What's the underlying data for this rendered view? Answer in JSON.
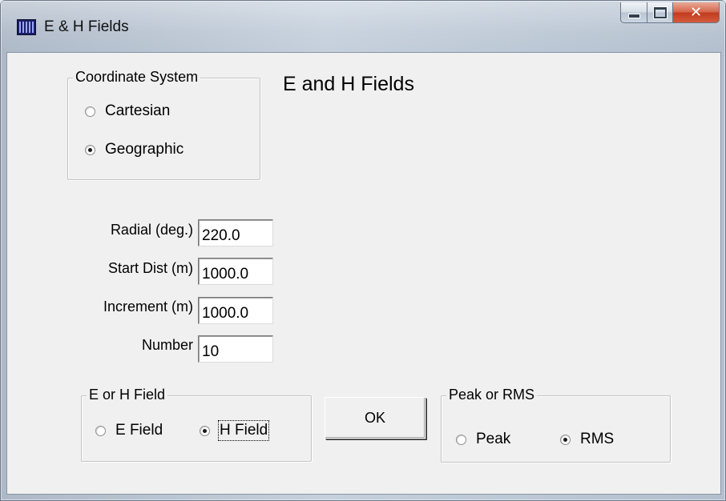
{
  "window": {
    "title": "E & H Fields",
    "icon": "grid-app-icon",
    "controls": {
      "minimize": "minimize-icon",
      "maximize": "maximize-icon",
      "close": "close-icon"
    }
  },
  "heading": "E and H Fields",
  "coordinate_system": {
    "legend": "Coordinate System",
    "options": [
      {
        "label": "Cartesian",
        "checked": false
      },
      {
        "label": "Geographic",
        "checked": true
      }
    ]
  },
  "fields": [
    {
      "label": "Radial (deg.)",
      "value": "220.0"
    },
    {
      "label": "Start Dist (m)",
      "value": "1000.0"
    },
    {
      "label": "Increment (m)",
      "value": "1000.0"
    },
    {
      "label": "Number",
      "value": "10"
    }
  ],
  "e_or_h": {
    "legend": "E or H Field",
    "options": [
      {
        "label": "E Field",
        "checked": false
      },
      {
        "label": "H Field",
        "checked": true
      }
    ]
  },
  "ok_label": "OK",
  "peak_or_rms": {
    "legend": "Peak or RMS",
    "options": [
      {
        "label": "Peak",
        "checked": false
      },
      {
        "label": "RMS",
        "checked": true
      }
    ]
  }
}
